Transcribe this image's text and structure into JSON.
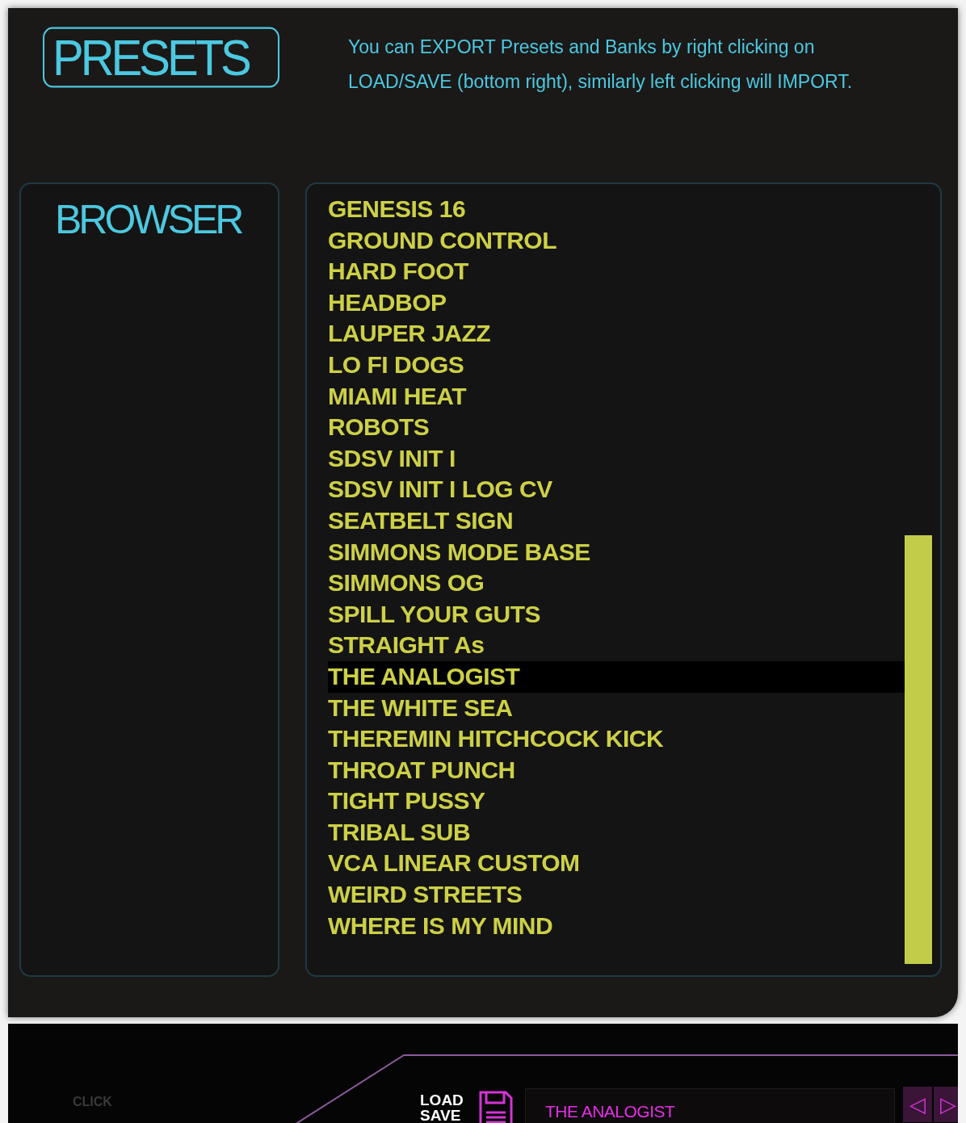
{
  "header": {
    "title": "PRESETS",
    "info": "You can EXPORT Presets and Banks by right clicking on LOAD/SAVE (bottom right), similarly left clicking will IMPORT."
  },
  "browser": {
    "title": "BROWSER"
  },
  "presets": [
    {
      "name": "GENESIS 16",
      "selected": false
    },
    {
      "name": "GROUND CONTROL",
      "selected": false
    },
    {
      "name": "HARD FOOT",
      "selected": false
    },
    {
      "name": "HEADBOP",
      "selected": false
    },
    {
      "name": "LAUPER JAZZ",
      "selected": false
    },
    {
      "name": "LO FI DOGS",
      "selected": false
    },
    {
      "name": "MIAMI HEAT",
      "selected": false
    },
    {
      "name": "ROBOTS",
      "selected": false
    },
    {
      "name": "SDSV INIT I",
      "selected": false
    },
    {
      "name": "SDSV INIT I LOG CV",
      "selected": false
    },
    {
      "name": "SEATBELT SIGN",
      "selected": false
    },
    {
      "name": "SIMMONS MODE BASE",
      "selected": false
    },
    {
      "name": "SIMMONS OG",
      "selected": false
    },
    {
      "name": "SPILL YOUR GUTS",
      "selected": false
    },
    {
      "name": "STRAIGHT As",
      "selected": false
    },
    {
      "name": "THE ANALOGIST",
      "selected": true
    },
    {
      "name": "THE WHITE SEA",
      "selected": false
    },
    {
      "name": "THEREMIN HITCHCOCK KICK",
      "selected": false
    },
    {
      "name": "THROAT PUNCH",
      "selected": false
    },
    {
      "name": "TIGHT PUSSY",
      "selected": false
    },
    {
      "name": "TRIBAL SUB",
      "selected": false
    },
    {
      "name": "VCA LINEAR CUSTOM",
      "selected": false
    },
    {
      "name": "WEIRD STREETS",
      "selected": false
    },
    {
      "name": "WHERE IS MY MIND",
      "selected": false
    }
  ],
  "bottom_bar": {
    "click_label": "CLICK",
    "load_label": "LOAD",
    "save_label": "SAVE",
    "current_preset": "THE ANALOGIST",
    "prev_arrow": "◁",
    "next_arrow": "▷"
  }
}
